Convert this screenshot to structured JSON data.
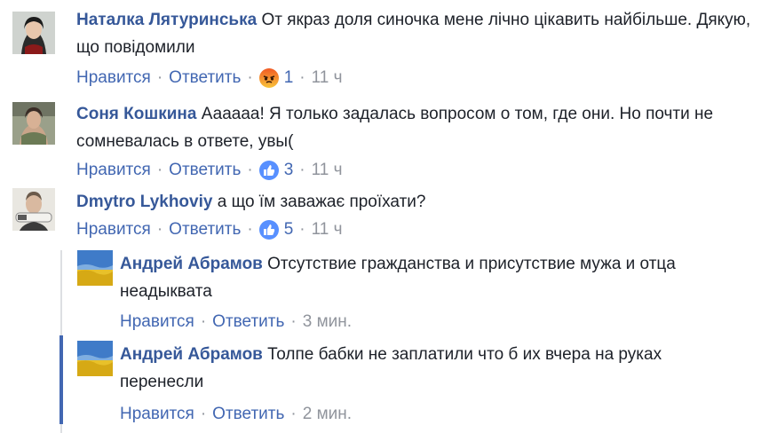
{
  "comments": [
    {
      "author": "Наталка Лятуринська",
      "text": "От якраз доля синочка мене лічно цікавить найбільше. Дякую, що повідомили",
      "like_label": "Нравится",
      "reply_label": "Ответить",
      "reaction_icon": "angry-reaction-icon",
      "reaction_count": "1",
      "time": "11 ч"
    },
    {
      "author": "Соня Кошкина",
      "text": "Аааааа! Я только задалась вопросом о том, где они. Но почти не сомневалась в ответе, увы(",
      "like_label": "Нравится",
      "reply_label": "Ответить",
      "reaction_icon": "like-reaction-icon",
      "reaction_count": "3",
      "time": "11 ч"
    },
    {
      "author": "Dmytro Lykhoviy",
      "text": "а що їм заважає проїхати?",
      "like_label": "Нравится",
      "reply_label": "Ответить",
      "reaction_icon": "like-reaction-icon",
      "reaction_count": "5",
      "time": "11 ч"
    }
  ],
  "replies": [
    {
      "author": "Андрей Абрамов",
      "text": "Отсутствие гражданства и присутствие мужа и отца неадыквата",
      "like_label": "Нравится",
      "reply_label": "Ответить",
      "time": "3 мин."
    },
    {
      "author": "Андрей Абрамов",
      "text": "Толпе бабки не заплатили что б их вчера на руках перенесли",
      "like_label": "Нравится",
      "reply_label": "Ответить",
      "time": "2 мин."
    }
  ],
  "separator": "·",
  "colors": {
    "author": "#365899",
    "link": "#4267b2",
    "meta": "#90949c",
    "like_reaction": "#5890ff",
    "highlight_bar": "#4267b2"
  }
}
